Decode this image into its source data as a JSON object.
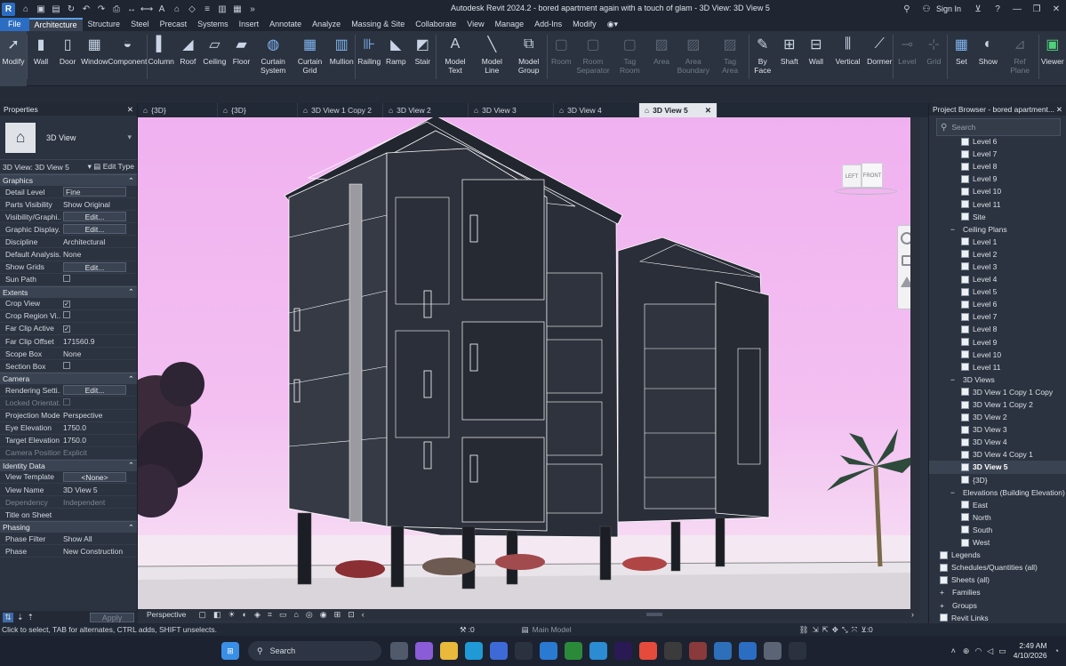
{
  "app": {
    "title": "Autodesk Revit 2024.2 - bored apartment again with a touch of glam - 3D View: 3D View 5",
    "sign_in": "Sign In",
    "logo": "R"
  },
  "menu": [
    "File",
    "Architecture",
    "Structure",
    "Steel",
    "Precast",
    "Systems",
    "Insert",
    "Annotate",
    "Analyze",
    "Massing & Site",
    "Collaborate",
    "View",
    "Manage",
    "Add-Ins",
    "Modify"
  ],
  "ribbon": {
    "tools": [
      {
        "label": "Modify",
        "icon": "cursor-icon"
      },
      {
        "label": "Wall",
        "icon": "wall-icon"
      },
      {
        "label": "Door",
        "icon": "door-icon"
      },
      {
        "label": "Window",
        "icon": "window-icon"
      },
      {
        "label": "Component",
        "icon": "component-icon"
      },
      {
        "label": "Column",
        "icon": "column-icon"
      },
      {
        "label": "Roof",
        "icon": "roof-icon"
      },
      {
        "label": "Ceiling",
        "icon": "ceiling-icon"
      },
      {
        "label": "Floor",
        "icon": "floor-icon"
      },
      {
        "label": "Curtain\nSystem",
        "icon": "curtain-system-icon"
      },
      {
        "label": "Curtain\nGrid",
        "icon": "curtain-grid-icon"
      },
      {
        "label": "Mullion",
        "icon": "mullion-icon"
      },
      {
        "label": "Railing",
        "icon": "railing-icon"
      },
      {
        "label": "Ramp",
        "icon": "ramp-icon"
      },
      {
        "label": "Stair",
        "icon": "stair-icon"
      },
      {
        "label": "Model\nText",
        "icon": "model-text-icon"
      },
      {
        "label": "Model\nLine",
        "icon": "model-line-icon"
      },
      {
        "label": "Model\nGroup",
        "icon": "model-group-icon"
      },
      {
        "label": "Room",
        "icon": "room-icon"
      },
      {
        "label": "Room\nSeparator",
        "icon": "room-separator-icon"
      },
      {
        "label": "Tag\nRoom",
        "icon": "tag-room-icon"
      },
      {
        "label": "Area",
        "icon": "area-icon"
      },
      {
        "label": "Area\nBoundary",
        "icon": "area-boundary-icon"
      },
      {
        "label": "Tag\nArea",
        "icon": "tag-area-icon"
      },
      {
        "label": "By\nFace",
        "icon": "by-face-icon"
      },
      {
        "label": "Shaft",
        "icon": "shaft-icon"
      },
      {
        "label": "Wall",
        "icon": "wall-opening-icon"
      },
      {
        "label": "Vertical",
        "icon": "vertical-icon"
      },
      {
        "label": "Dormer",
        "icon": "dormer-icon"
      },
      {
        "label": "Level",
        "icon": "level-icon"
      },
      {
        "label": "Grid",
        "icon": "grid-icon"
      },
      {
        "label": "Set",
        "icon": "set-icon"
      },
      {
        "label": "Show",
        "icon": "show-icon"
      },
      {
        "label": "Ref\nPlane",
        "icon": "ref-plane-icon"
      },
      {
        "label": "Viewer",
        "icon": "viewer-icon"
      }
    ]
  },
  "properties": {
    "title": "Properties",
    "type_name": "3D View",
    "view_selector": "3D View: 3D View 5",
    "edit_type": "Edit Type",
    "groups": [
      {
        "name": "Graphics",
        "rows": [
          {
            "k": "Detail Level",
            "v": "Fine",
            "kind": "input"
          },
          {
            "k": "Parts Visibility",
            "v": "Show Original",
            "kind": "text"
          },
          {
            "k": "Visibility/Graphi...",
            "v": "Edit...",
            "kind": "button"
          },
          {
            "k": "Graphic Display...",
            "v": "Edit...",
            "kind": "button"
          },
          {
            "k": "Discipline",
            "v": "Architectural",
            "kind": "text"
          },
          {
            "k": "Default Analysis...",
            "v": "None",
            "kind": "text"
          },
          {
            "k": "Show Grids",
            "v": "Edit...",
            "kind": "button"
          },
          {
            "k": "Sun Path",
            "v": "",
            "kind": "check",
            "checked": false
          }
        ]
      },
      {
        "name": "Extents",
        "rows": [
          {
            "k": "Crop View",
            "v": "",
            "kind": "check",
            "checked": true
          },
          {
            "k": "Crop Region Vi...",
            "v": "",
            "kind": "check",
            "checked": false
          },
          {
            "k": "Far Clip Active",
            "v": "",
            "kind": "check",
            "checked": true
          },
          {
            "k": "Far Clip Offset",
            "v": "171560.9",
            "kind": "text"
          },
          {
            "k": "Scope Box",
            "v": "None",
            "kind": "text"
          },
          {
            "k": "Section Box",
            "v": "",
            "kind": "check",
            "checked": false
          }
        ]
      },
      {
        "name": "Camera",
        "rows": [
          {
            "k": "Rendering Setti...",
            "v": "Edit...",
            "kind": "button"
          },
          {
            "k": "Locked Orientat...",
            "v": "",
            "kind": "check",
            "checked": false,
            "dim": true
          },
          {
            "k": "Projection Mode",
            "v": "Perspective",
            "kind": "text"
          },
          {
            "k": "Eye Elevation",
            "v": "1750.0",
            "kind": "text"
          },
          {
            "k": "Target Elevation",
            "v": "1750.0",
            "kind": "text"
          },
          {
            "k": "Camera Position",
            "v": "Explicit",
            "kind": "text",
            "dim": true
          }
        ]
      },
      {
        "name": "Identity Data",
        "rows": [
          {
            "k": "View Template",
            "v": "<None>",
            "kind": "button"
          },
          {
            "k": "View Name",
            "v": "3D View 5",
            "kind": "text"
          },
          {
            "k": "Dependency",
            "v": "Independent",
            "kind": "text",
            "dim": true
          },
          {
            "k": "Title on Sheet",
            "v": "",
            "kind": "text"
          }
        ]
      },
      {
        "name": "Phasing",
        "rows": [
          {
            "k": "Phase Filter",
            "v": "Show All",
            "kind": "text"
          },
          {
            "k": "Phase",
            "v": "New Construction",
            "kind": "text"
          }
        ]
      }
    ],
    "apply": "Apply"
  },
  "tabs": [
    {
      "label": "{3D}",
      "active": false
    },
    {
      "label": "{3D}",
      "active": false
    },
    {
      "label": "3D View 1 Copy 2",
      "active": false
    },
    {
      "label": "3D View 2",
      "active": false
    },
    {
      "label": "3D View 3",
      "active": false
    },
    {
      "label": "3D View 4",
      "active": false
    },
    {
      "label": "3D View 5",
      "active": true
    }
  ],
  "viewcube": {
    "left": "LEFT",
    "front": "FRONT"
  },
  "view_bar": {
    "mode": "Perspective"
  },
  "browser": {
    "title": "Project Browser - bored apartment...",
    "search_placeholder": "Search",
    "items": [
      {
        "label": "Level 6",
        "indent": 2,
        "icon": true
      },
      {
        "label": "Level 7",
        "indent": 2,
        "icon": true
      },
      {
        "label": "Level 8",
        "indent": 2,
        "icon": true
      },
      {
        "label": "Level 9",
        "indent": 2,
        "icon": true
      },
      {
        "label": "Level 10",
        "indent": 2,
        "icon": true
      },
      {
        "label": "Level 11",
        "indent": 2,
        "icon": true
      },
      {
        "label": "Site",
        "indent": 2,
        "icon": true
      },
      {
        "label": "Ceiling Plans",
        "indent": 1,
        "toggle": "−"
      },
      {
        "label": "Level 1",
        "indent": 2,
        "icon": true
      },
      {
        "label": "Level 2",
        "indent": 2,
        "icon": true
      },
      {
        "label": "Level 3",
        "indent": 2,
        "icon": true
      },
      {
        "label": "Level 4",
        "indent": 2,
        "icon": true
      },
      {
        "label": "Level 5",
        "indent": 2,
        "icon": true
      },
      {
        "label": "Level 6",
        "indent": 2,
        "icon": true
      },
      {
        "label": "Level 7",
        "indent": 2,
        "icon": true
      },
      {
        "label": "Level 8",
        "indent": 2,
        "icon": true
      },
      {
        "label": "Level 9",
        "indent": 2,
        "icon": true
      },
      {
        "label": "Level 10",
        "indent": 2,
        "icon": true
      },
      {
        "label": "Level 11",
        "indent": 2,
        "icon": true
      },
      {
        "label": "3D Views",
        "indent": 1,
        "toggle": "−"
      },
      {
        "label": "3D View 1 Copy 1 Copy",
        "indent": 2,
        "icon": true
      },
      {
        "label": "3D View 1 Copy 2",
        "indent": 2,
        "icon": true
      },
      {
        "label": "3D View 2",
        "indent": 2,
        "icon": true
      },
      {
        "label": "3D View 3",
        "indent": 2,
        "icon": true
      },
      {
        "label": "3D View 4",
        "indent": 2,
        "icon": true
      },
      {
        "label": "3D View 4 Copy 1",
        "indent": 2,
        "icon": true
      },
      {
        "label": "3D View 5",
        "indent": 2,
        "icon": true,
        "selected": true
      },
      {
        "label": "{3D}",
        "indent": 2,
        "icon": true
      },
      {
        "label": "Elevations (Building Elevation)",
        "indent": 1,
        "toggle": "−"
      },
      {
        "label": "East",
        "indent": 2,
        "icon": true
      },
      {
        "label": "North",
        "indent": 2,
        "icon": true
      },
      {
        "label": "South",
        "indent": 2,
        "icon": true
      },
      {
        "label": "West",
        "indent": 2,
        "icon": true
      },
      {
        "label": "Legends",
        "indent": 0,
        "icon": true
      },
      {
        "label": "Schedules/Quantities (all)",
        "indent": 0,
        "icon": true
      },
      {
        "label": "Sheets (all)",
        "indent": 0,
        "icon": true
      },
      {
        "label": "Families",
        "indent": 0,
        "toggle": "+"
      },
      {
        "label": "Groups",
        "indent": 0,
        "toggle": "+"
      },
      {
        "label": "Revit Links",
        "indent": 0,
        "icon": true
      }
    ]
  },
  "status": {
    "hint": "Click to select, TAB for alternates, CTRL adds, SHIFT unselects.",
    "count_a": ":0",
    "model": "Main Model",
    "count_b": ":0"
  },
  "taskbar": {
    "search": "Search",
    "time": "2:49 AM",
    "date": "4/10/2026",
    "apps": [
      {
        "name": "windows-start-icon",
        "color": "#3a8ee6"
      },
      {
        "name": "task-view-icon",
        "color": "#505a6a"
      },
      {
        "name": "copilot-icon",
        "color": "#8a5cd8"
      },
      {
        "name": "file-explorer-icon",
        "color": "#e8b93a"
      },
      {
        "name": "edge-icon",
        "color": "#1f9ad6"
      },
      {
        "name": "store-icon",
        "color": "#3d6ad6"
      },
      {
        "name": "app-icon",
        "color": "#2a3240"
      },
      {
        "name": "maps-icon",
        "color": "#2a7ad1"
      },
      {
        "name": "xbox-icon",
        "color": "#2a8a3a"
      },
      {
        "name": "vpn-icon",
        "color": "#2b8bd3"
      },
      {
        "name": "premiere-icon",
        "color": "#2a1a54"
      },
      {
        "name": "chrome-icon",
        "color": "#e44b3b"
      },
      {
        "name": "live-icon",
        "color": "#3b3b3b"
      },
      {
        "name": "winrar-icon",
        "color": "#8a3a3a"
      },
      {
        "name": "photos-icon",
        "color": "#2d6fb8"
      },
      {
        "name": "revit-taskbar-icon",
        "color": "#2b6dc3"
      },
      {
        "name": "settings-icon",
        "color": "#5a6474"
      },
      {
        "name": "network-icon",
        "color": "#2a3240"
      }
    ]
  }
}
